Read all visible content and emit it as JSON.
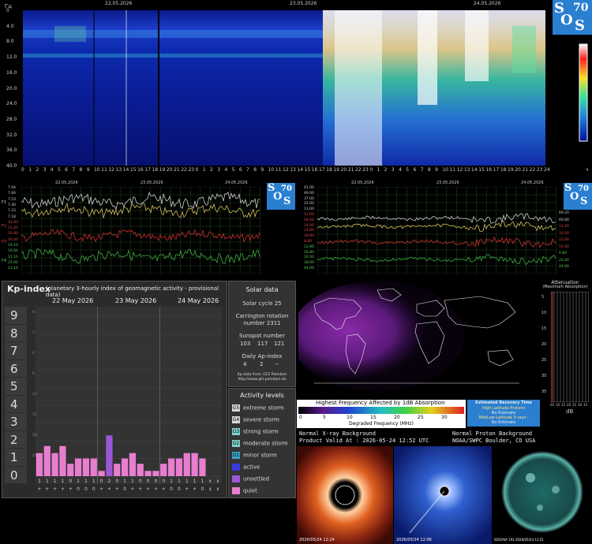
{
  "top_spectrogram": {
    "unit_label": "Гц",
    "dates": [
      "22.05.2026",
      "23.05.2026",
      "24.05.2026"
    ],
    "y_ticks": [
      "0",
      "4.0",
      "8.0",
      "12.0",
      "16.0",
      "20.0",
      "24.0",
      "28.0",
      "32.0",
      "36.0",
      "40.0"
    ],
    "x_ticks": [
      "0",
      "1",
      "2",
      "3",
      "4",
      "5",
      "6",
      "7",
      "8",
      "9",
      "10",
      "11",
      "12",
      "13",
      "14",
      "15",
      "16",
      "17",
      "18",
      "19",
      "20",
      "21",
      "22",
      "23",
      "0",
      "1",
      "2",
      "3",
      "4",
      "5",
      "6",
      "7",
      "8",
      "9",
      "10",
      "11",
      "12",
      "13",
      "14",
      "15",
      "16",
      "17",
      "18",
      "19",
      "20",
      "21",
      "22",
      "23",
      "0",
      "1",
      "2",
      "3",
      "4",
      "5",
      "6",
      "7",
      "8",
      "9",
      "10",
      "11",
      "12",
      "13",
      "14",
      "15",
      "16",
      "17",
      "18",
      "19",
      "20",
      "21",
      "22",
      "23",
      "24"
    ],
    "x_end_label": "ч",
    "logo_text": [
      "S",
      "O",
      "S",
      "70"
    ]
  },
  "left_chart": {
    "dates": [
      "22.05.2026",
      "23.05.2026",
      "24.05.2026"
    ],
    "y_left": [
      "7.94",
      "7.66",
      "7.53",
      "7.40",
      "7.23",
      "7.18",
      "14.60",
      "15.40",
      "20.80",
      "26.00",
      "19.10",
      "19.84",
      "21.10",
      "22.60",
      "23.10"
    ],
    "side_labels": [
      "F1",
      "F2",
      "F3",
      "F4"
    ],
    "logo_text": [
      "S",
      "O",
      "S",
      "70"
    ]
  },
  "right_chart": {
    "dates": [
      "22.05.2026",
      "23.05.2026",
      "24.05.2026"
    ],
    "y_left": [
      "61.00",
      "49.00",
      "37.00",
      "25.00",
      "13.00",
      "12.60",
      "18.40",
      "14.40",
      "24.80",
      "30.80",
      "8.80",
      "12.80",
      "16.80",
      "32.00",
      "38.00",
      "44.00"
    ],
    "y_right": [
      "69.20",
      "60.80",
      "12.40",
      "10.00",
      "12.80",
      "14.00",
      "6.80",
      "22.40",
      "44.80"
    ],
    "logo_text": [
      "S",
      "O",
      "S",
      "70"
    ]
  },
  "kp_panel": {
    "title": "Kp-index",
    "subtitle": "(planetary 3-hourly index of geomagnetic activity - provisional data)",
    "days": [
      "22 May 2026",
      "23 May 2026",
      "24 May 2026"
    ],
    "levels": [
      "9",
      "8",
      "7",
      "6",
      "5",
      "4",
      "3",
      "2",
      "1",
      "0"
    ],
    "hours_top": [
      "0",
      "3",
      "6",
      "9",
      "12",
      "15",
      "18",
      "21"
    ],
    "hours_bottom": [
      "3",
      "6",
      "9",
      "12",
      "15",
      "18",
      "21",
      "24"
    ],
    "colors": {
      "quiet": "#e87ed0",
      "unsettled": "#9b57d6",
      "active": "#3a3adc",
      "grid": "#444"
    }
  },
  "chart_data": {
    "type": "bar",
    "title": "Kp-index",
    "categories": [
      "22 May 0-3",
      "22 May 3-6",
      "22 May 6-9",
      "22 May 9-12",
      "22 May 12-15",
      "22 May 15-18",
      "22 May 18-21",
      "22 May 21-24",
      "23 May 0-3",
      "23 May 3-6",
      "23 May 6-9",
      "23 May 9-12",
      "23 May 12-15",
      "23 May 15-18",
      "23 May 18-21",
      "23 May 21-24",
      "24 May 0-3",
      "24 May 3-6",
      "24 May 6-9",
      "24 May 9-12",
      "24 May 12-15",
      "24 May 15-18",
      "24 May 18-21",
      "24 May 21-24"
    ],
    "values": [
      1.3,
      1.7,
      1.3,
      1.7,
      0.7,
      1.0,
      1.0,
      1.0,
      0.3,
      2.3,
      0.7,
      1.0,
      1.3,
      0.7,
      0.3,
      0.3,
      0.7,
      1.0,
      1.0,
      1.3,
      1.3,
      1.0,
      null,
      null
    ],
    "ylim": [
      0,
      9
    ],
    "bar_labels_top": [
      "1",
      "1",
      "1",
      "1",
      "0",
      "1",
      "1",
      "1",
      "0",
      "2",
      "0",
      "1",
      "1",
      "0",
      "0",
      "0",
      "0",
      "1",
      "1",
      "1",
      "1",
      "1",
      "x",
      "x"
    ],
    "bar_labels_bottom": [
      "+",
      "+",
      "+",
      "+",
      "+",
      "0",
      "0",
      "0",
      "+",
      "+",
      "+",
      "0",
      "+",
      "+",
      "+",
      "+",
      "+",
      "0",
      "0",
      "+",
      "+",
      "0",
      "x",
      "x"
    ],
    "grid": true
  },
  "solar_data": {
    "title": "Solar data",
    "cycle": "Solar cycle 25",
    "carrington_label": "Carrington rotation",
    "carrington_value": "number 2311",
    "sunspot_label": "Sunspot number",
    "sunspot_values": [
      "103",
      "117",
      "121"
    ],
    "ap_label": "Daily Ap-index",
    "ap_values": [
      "4",
      "2",
      "--"
    ],
    "source_1": "Kp-data from: GFZ Potsdam",
    "source_2": "http://www.gfz-potsdam.de"
  },
  "activity_levels": {
    "title": "Activity levels",
    "items": [
      {
        "code": "G5",
        "label": "extreme storm",
        "color": "#d9d9d9"
      },
      {
        "code": "G4",
        "label": "severe storm",
        "color": "#d9d9d9"
      },
      {
        "code": "G3",
        "label": "strong storm",
        "color": "#7fd3c8"
      },
      {
        "code": "G2",
        "label": "moderate storm",
        "color": "#7fd3c8"
      },
      {
        "code": "G1",
        "label": "minor storm",
        "color": "#3aa4c8"
      },
      {
        "code": "",
        "label": "active",
        "color": "#3a3adc"
      },
      {
        "code": "",
        "label": "unsettled",
        "color": "#9b57d6"
      },
      {
        "code": "",
        "label": "quiet",
        "color": "#e87ed0"
      }
    ]
  },
  "drap": {
    "legend_title": "Highest Frequency Affected by 1dB Absorption",
    "legend_ticks": [
      "0",
      "5",
      "10",
      "15",
      "20",
      "25",
      "30",
      "35"
    ],
    "legend_caption": "Degraded Frequency (MHz)",
    "recovery_title": "Estimated Recovery Time",
    "hlp_label": "High Latitude Protons",
    "hlp_value": "No Estimate",
    "mlx_label": "Mid/Low Latitude X-rays :",
    "mlx_value": "No Estimate",
    "attenuation_title": "Attenuation",
    "attenuation_sub": "(Maximum Absorption)",
    "attenuation_ticks": [
      "5",
      "10",
      "15",
      "20",
      "25",
      "30",
      "35"
    ],
    "attenuation_x": [
      "05",
      "10",
      "15",
      "20",
      "25",
      "30",
      "35"
    ],
    "attenuation_unit": "dB",
    "xray_bg": "Normal X-ray Background",
    "product_valid": "Product Valid At : 2026-05-24 12:52 UTC",
    "proton_bg": "Normal Proton Background",
    "noaa": "NOAA/SWPC Boulder, CO USA"
  },
  "images": {
    "lasco_c2_time": "2026/05/24 12:24",
    "lasco_c3_time": "2026/05/24 12:06",
    "sdo_caption": "SDO/AIA 193 2026/05/24 12:51"
  }
}
